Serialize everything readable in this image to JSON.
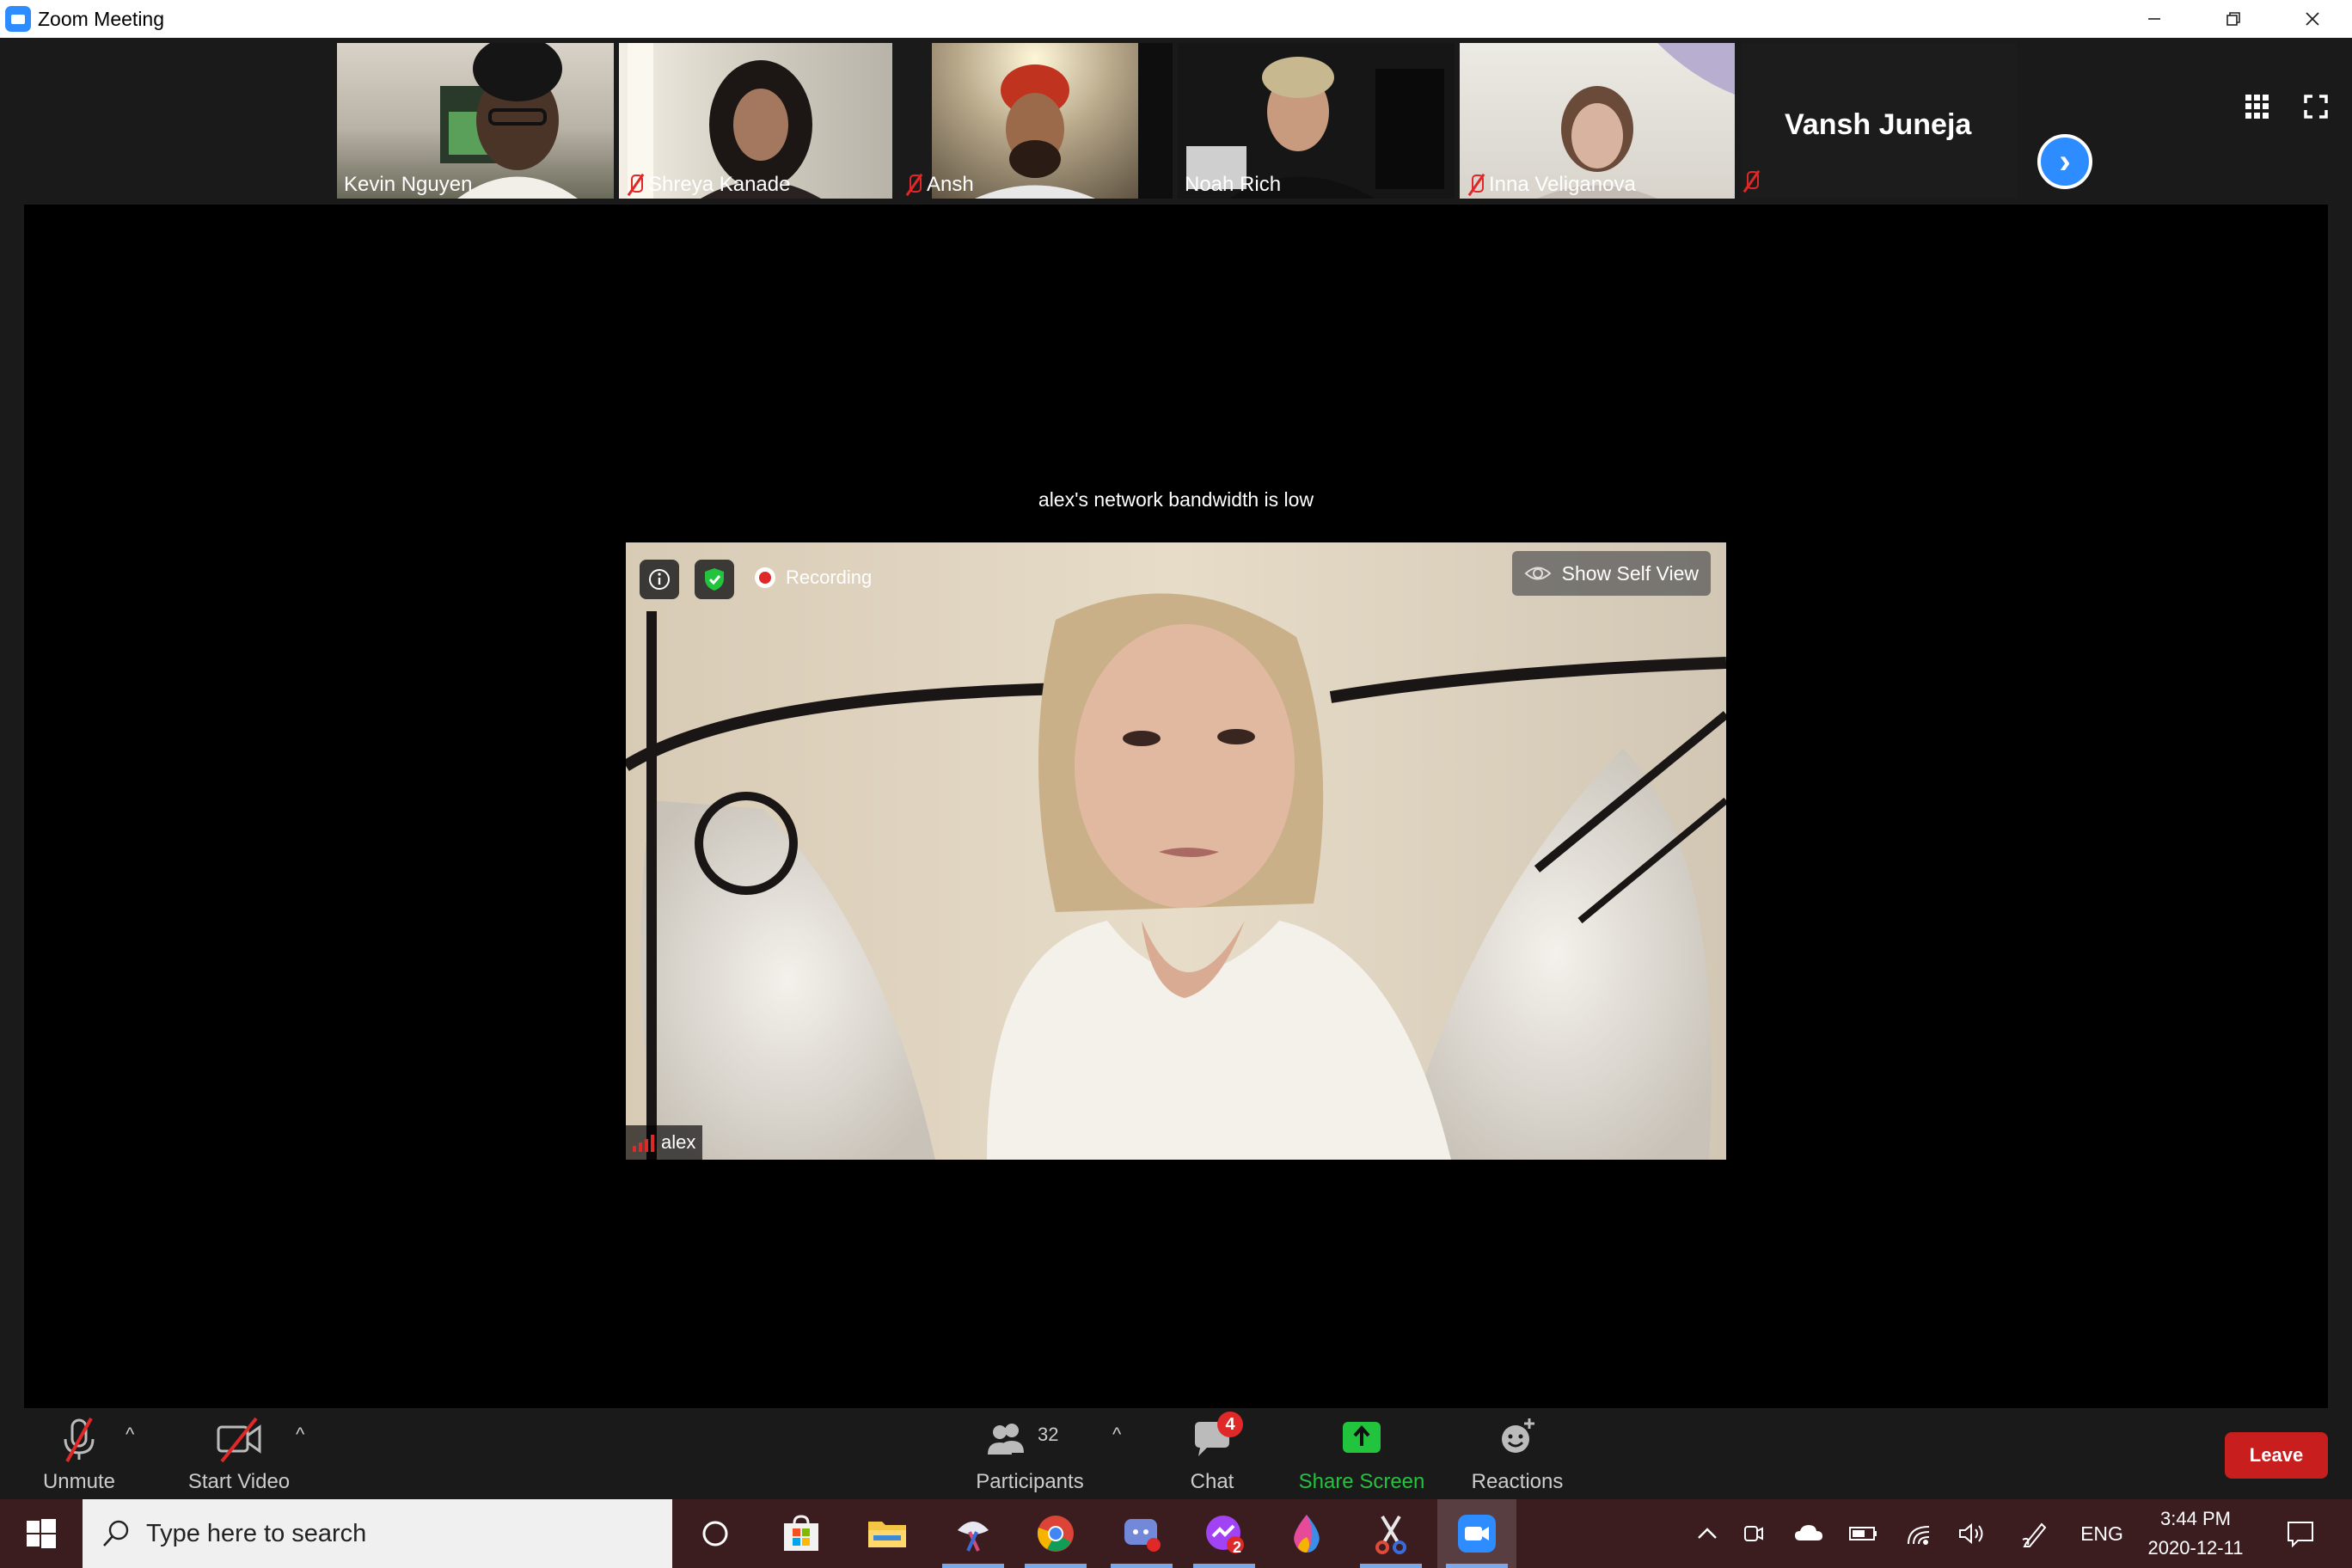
{
  "window": {
    "title": "Zoom Meeting",
    "controls": [
      "minimize-icon",
      "restore-icon",
      "close-icon"
    ]
  },
  "gallery": {
    "participants": [
      {
        "name": "Kevin Nguyen",
        "muted": false
      },
      {
        "name": "Shreya Kanade",
        "muted": true
      },
      {
        "name": "Ansh",
        "muted": true
      },
      {
        "name": "Noah Rich",
        "muted": false
      },
      {
        "name": "Inna Veliganova",
        "muted": true
      }
    ],
    "extra_tile": {
      "name": "Vansh Juneja",
      "muted": true
    },
    "next_label": "›"
  },
  "stage": {
    "bandwidth_notice": "alex's network bandwidth is low",
    "recording_label": "Recording",
    "show_self_view_label": "Show Self View",
    "active_speaker": "alex",
    "network_quality": "low"
  },
  "toolbar": {
    "unmute_label": "Unmute",
    "start_video_label": "Start Video",
    "participants_label": "Participants",
    "participants_count": "32",
    "chat_label": "Chat",
    "chat_badge": "4",
    "share_screen_label": "Share Screen",
    "reactions_label": "Reactions",
    "leave_label": "Leave"
  },
  "taskbar": {
    "search_placeholder": "Type here to search",
    "language": "ENG",
    "time": "3:44 PM",
    "date": "2020-12-11",
    "messenger_badge": "2"
  },
  "colors": {
    "zoom_blue": "#2d8cff",
    "mute_red": "#e02828",
    "share_green": "#22c33d",
    "leave_red": "#c81e1e",
    "taskbar": "#3b1d20"
  }
}
